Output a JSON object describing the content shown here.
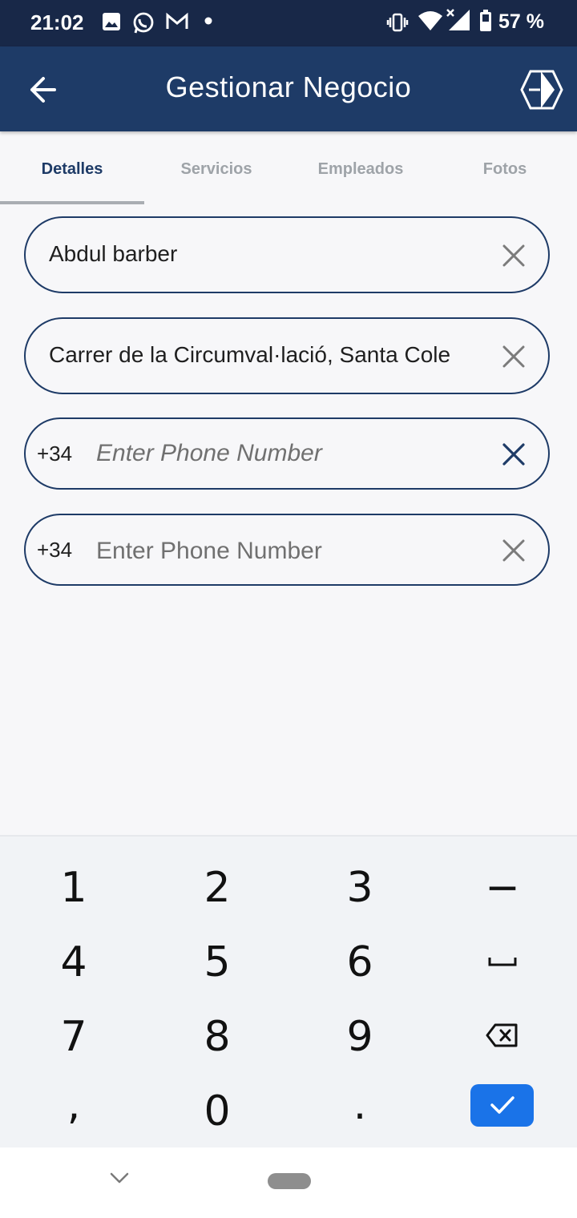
{
  "status_bar": {
    "time": "21:02",
    "battery_text": "57 %",
    "icons": [
      "image-icon",
      "whatsapp-icon",
      "gmail-icon",
      "dot-icon",
      "vibrate-icon",
      "wifi-icon",
      "signal-icon",
      "battery-icon"
    ]
  },
  "app_bar": {
    "title": "Gestionar Negocio",
    "back_icon": "arrow-left-icon",
    "logo_icon": "hexagon-logo-icon"
  },
  "tabs": [
    {
      "label": "Detalles",
      "active": true
    },
    {
      "label": "Servicios",
      "active": false
    },
    {
      "label": "Empleados",
      "active": false
    },
    {
      "label": "Fotos",
      "active": false
    }
  ],
  "fields": {
    "name_value": "Abdul barber",
    "address_value": "Carrer de la Circumval·lació, Santa Cole",
    "phone1_prefix": "+34",
    "phone1_placeholder": "Enter Phone Number",
    "phone2_prefix": "+34",
    "phone2_placeholder": "Enter Phone Number"
  },
  "keyboard": {
    "keys": [
      "1",
      "2",
      "3",
      "−",
      "4",
      "5",
      "6",
      "␣",
      "7",
      "8",
      "9",
      "⌫",
      ",",
      "0",
      ".",
      "✓"
    ],
    "display": {
      "k1": "1",
      "k2": "2",
      "k3": "3",
      "minus": "−",
      "k4": "4",
      "k5": "5",
      "k6": "6",
      "k7": "7",
      "k8": "8",
      "k9": "9",
      "comma": ",",
      "k0": "0",
      "period": "."
    }
  },
  "colors": {
    "status_bar": "#182848",
    "app_bar": "#1e3b67",
    "accent": "#1a73e8",
    "background": "#f7f7f9"
  }
}
